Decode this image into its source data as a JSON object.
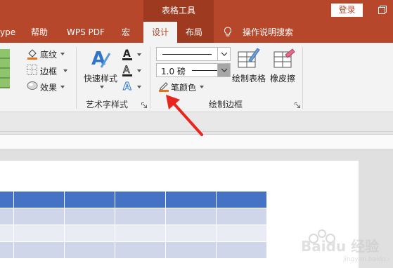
{
  "titlebar": {
    "context_group": "表格工具",
    "login_label": "登录",
    "restore_icon": "restore-window-icon"
  },
  "tabs": [
    {
      "label": "ype",
      "active": false
    },
    {
      "label": "帮助",
      "active": false
    },
    {
      "label": "WPS PDF",
      "active": false
    },
    {
      "label": "宏",
      "active": false
    },
    {
      "label": "设计",
      "active": true
    },
    {
      "label": "布局",
      "active": false
    },
    {
      "label": "操作说明搜索",
      "active": false,
      "icon": "lightbulb-icon"
    }
  ],
  "ribbon": {
    "shading": {
      "label": "底纹",
      "icon": "paint-bucket-icon"
    },
    "borders": {
      "label": "边框",
      "icon": "borders-icon"
    },
    "effects": {
      "label": "效果",
      "icon": "effects-icon"
    },
    "wordart": {
      "quick_styles_label": "快速样式",
      "group_label": "艺术字样式",
      "text_fill_icon": "text-fill-icon",
      "text_outline_icon": "text-outline-icon",
      "text_effects_icon": "text-effects-icon"
    },
    "draw_borders": {
      "line_style_icon": "line-style-icon",
      "weight_value": "1.0 磅",
      "pen_color_label": "笔颜色",
      "pen_color_accent": "#e0761a",
      "draw_table_label": "绘制表格",
      "eraser_label": "橡皮擦",
      "group_label": "绘制边框"
    }
  },
  "document": {
    "table": {
      "header_color": "#4472c4",
      "band_dark": "#cfd6ea",
      "band_light": "#e9ecf5"
    }
  },
  "watermark": {
    "text": "Baidu 经验",
    "url": "jingyan.baidu.com"
  }
}
